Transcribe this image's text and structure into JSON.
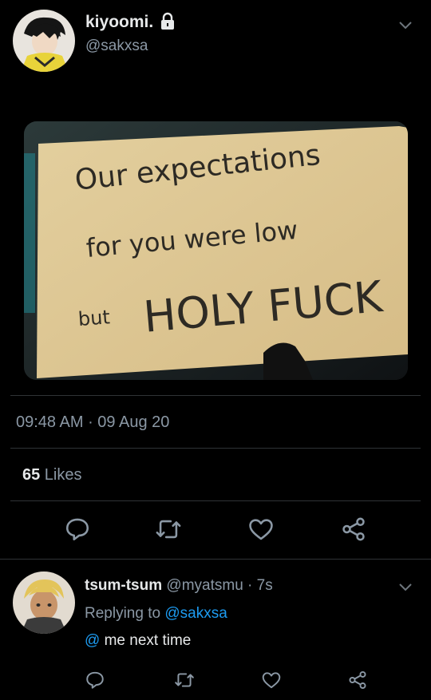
{
  "tweet": {
    "author_name": "kiyoomi.",
    "author_handle": "@sakxsa",
    "image_text": {
      "line1": "Our expectations",
      "line2": "for you were low",
      "line3_a": "but",
      "line3_b": "HOLY FUCK"
    },
    "time": "09:48 AM",
    "separator": " · ",
    "date": "09 Aug 20",
    "likes_count": "65",
    "likes_label": " Likes"
  },
  "reply": {
    "author_name": "tsum-tsum",
    "author_handle": "@myatsmu",
    "age": " · 7s",
    "replying_prefix": "Replying to ",
    "replying_handle": "@sakxsa",
    "mention": "@",
    "text": " me next time"
  },
  "icons": {
    "lock": "lock-icon",
    "chevron": "chevron-down-icon",
    "reply": "reply-icon",
    "retweet": "retweet-icon",
    "like": "heart-icon",
    "share": "share-icon"
  },
  "colors": {
    "background": "#000000",
    "accent": "#1d9bf0",
    "muted": "#8b98a5"
  }
}
